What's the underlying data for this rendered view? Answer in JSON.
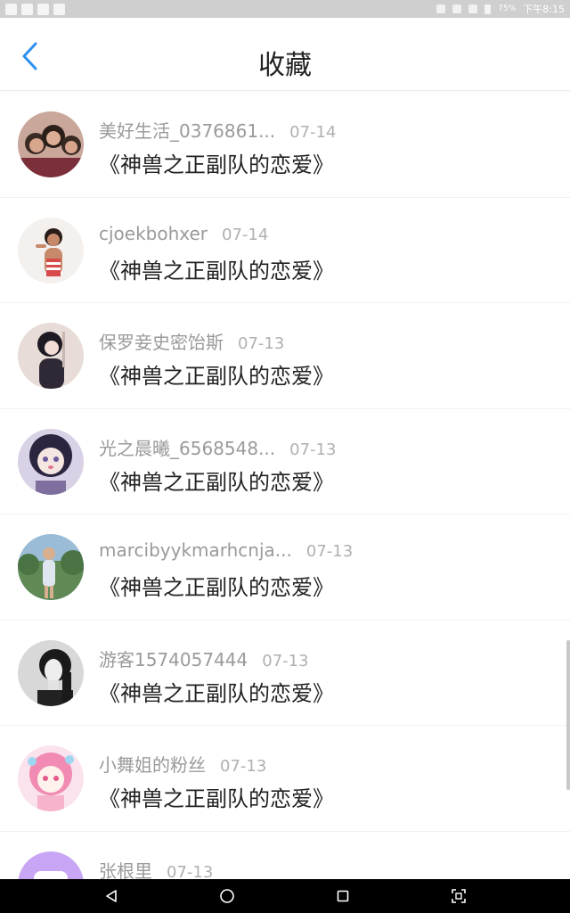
{
  "status_bar": {
    "battery": "75%",
    "time": "下午8:15"
  },
  "header": {
    "title": "收藏"
  },
  "items": [
    {
      "name": "美好生活_0376861...",
      "date": "07-14",
      "title": "《神兽之正副队的恋爱》",
      "avatar_color": "#7a4a3a"
    },
    {
      "name": "cjoekbohxer",
      "date": "07-14",
      "title": "《神兽之正副队的恋爱》",
      "avatar_color": "#e7d8d2"
    },
    {
      "name": "保罗妾史密饴斯",
      "date": "07-13",
      "title": "《神兽之正副队的恋爱》",
      "avatar_color": "#3a3340"
    },
    {
      "name": "光之晨曦_6568548...",
      "date": "07-13",
      "title": "《神兽之正副队的恋爱》",
      "avatar_color": "#3b3450"
    },
    {
      "name": "marcibyykmarhcnja...",
      "date": "07-13",
      "title": "《神兽之正副队的恋爱》",
      "avatar_color": "#6b8a60"
    },
    {
      "name": "游客1574057444",
      "date": "07-13",
      "title": "《神兽之正副队的恋爱》",
      "avatar_color": "#9a9a9a"
    },
    {
      "name": "小舞姐的粉丝",
      "date": "07-13",
      "title": "《神兽之正副队的恋爱》",
      "avatar_color": "#f3c1d4"
    },
    {
      "name": "张根里",
      "date": "07-13",
      "title": "",
      "avatar_color": "#c9a6f5"
    }
  ],
  "colors": {
    "accent": "#2d8ff0",
    "text_primary": "#222222",
    "text_secondary": "#9a9a9a"
  }
}
